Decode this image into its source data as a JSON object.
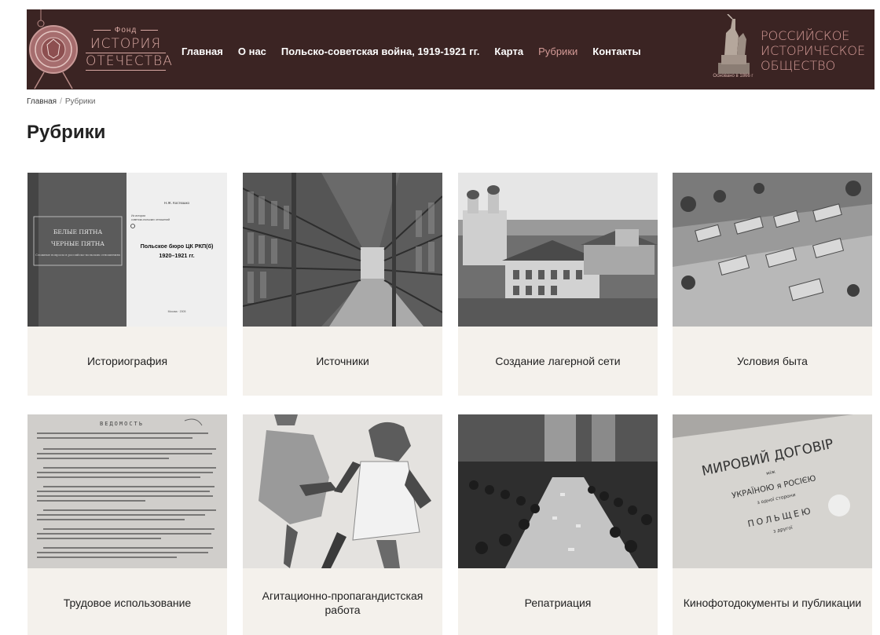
{
  "header": {
    "logo_left": {
      "fond": "Фонд",
      "line1": "ИСТОРИЯ",
      "line2": "ОТЕЧЕСТВА"
    },
    "nav": [
      {
        "label": "Главная",
        "active": false
      },
      {
        "label": "О нас",
        "active": false
      },
      {
        "label": "Польско-советская война, 1919-1921 гг.",
        "active": false
      },
      {
        "label": "Карта",
        "active": false
      },
      {
        "label": "Рубрики",
        "active": true
      },
      {
        "label": "Контакты",
        "active": false
      }
    ],
    "logo_right": {
      "line1": "РОССИЙСКОЕ",
      "line2": "ИСТОРИЧЕСКОЕ",
      "line3": "ОБЩЕСТВО",
      "caption": "Основано в 1866 г"
    }
  },
  "breadcrumb": {
    "home": "Главная",
    "separator": "/",
    "current": "Рубрики"
  },
  "page_title": "Рубрики",
  "cards": [
    {
      "label": "Историография",
      "image": {
        "left_title_1": "БЕЛЫЕ ПЯТНА",
        "left_title_2": "ЧЕРНЫЕ ПЯТНА",
        "left_sub": "Сложные вопросы в российско-польских отношениях",
        "author": "Н.Ж. Костюшко",
        "small_1": "Из истории",
        "small_2": "советско-польских отношений",
        "right_title_1": "Польское бюро ЦК РКП(б)",
        "right_title_2": "1920–1921 гг.",
        "footer": "Москва · 2005"
      }
    },
    {
      "label": "Источники"
    },
    {
      "label": "Создание лагерной сети"
    },
    {
      "label": "Условия быта"
    },
    {
      "label": "Трудовое использование",
      "image": {
        "doc_title": "ВЕДОМОСТЬ"
      }
    },
    {
      "label": "Агитационно-пропагандистская работа"
    },
    {
      "label": "Репатриация"
    },
    {
      "label": "Кинофотодокументы и публикации",
      "image": {
        "line1": "МИРОВИЙ ДОГОВІР",
        "line2": "між",
        "line3": "УКРАЇНОЮ я РОСІЄЮ",
        "line4": "з одної сторони",
        "line5": "ПОЛЬЩЕЮ",
        "line6": "з другої"
      }
    }
  ]
}
